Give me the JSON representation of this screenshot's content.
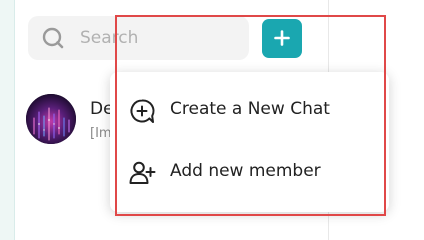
{
  "search": {
    "placeholder": "Search"
  },
  "toolbar": {
    "add_icon": "plus-icon",
    "accent_color": "#1aa7b0"
  },
  "chat_list": {
    "items": [
      {
        "name": "De",
        "preview": "[Im",
        "avatar": "abstract-purple-image"
      }
    ]
  },
  "dropdown": {
    "items": [
      {
        "label": "Create a New Chat",
        "icon": "chat-add-icon"
      },
      {
        "label": "Add new member",
        "icon": "user-add-icon"
      }
    ]
  },
  "highlight_color": "#e04848"
}
